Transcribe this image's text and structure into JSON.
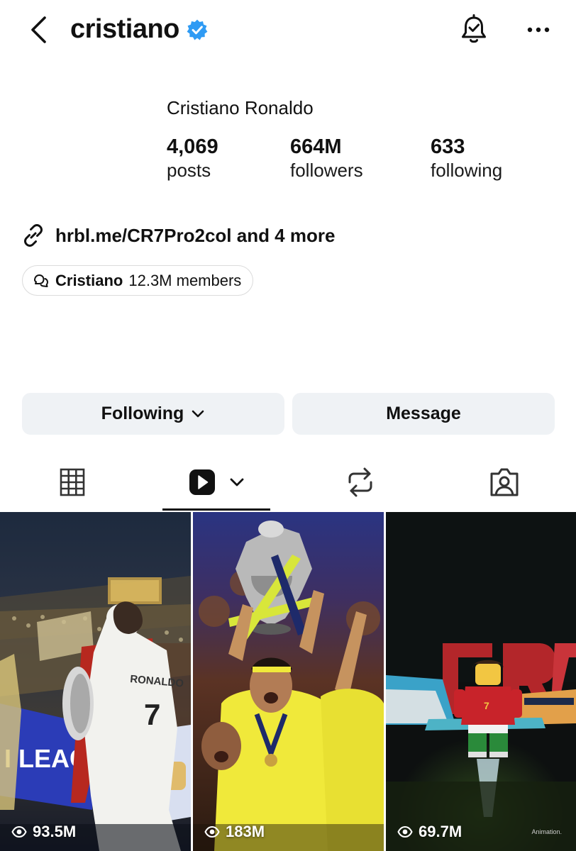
{
  "header": {
    "username": "cristiano",
    "icons": {
      "back": "back-chevron-icon",
      "verified": "verified-badge-icon",
      "notifications": "bell-check-icon",
      "more": "more-dots-icon"
    },
    "colors": {
      "verified": "#2f9bf4"
    }
  },
  "profile": {
    "full_name": "Cristiano Ronaldo",
    "stats": [
      {
        "value": "4,069",
        "label": "posts"
      },
      {
        "value": "664M",
        "label": "followers"
      },
      {
        "value": "633",
        "label": "following"
      }
    ],
    "link_text": "hrbl.me/CR7Pro2col and 4 more",
    "community": {
      "name": "Cristiano",
      "members": "12.3M members"
    }
  },
  "actions": {
    "following_label": "Following",
    "message_label": "Message"
  },
  "tabs": [
    {
      "name": "grid",
      "icon": "grid-icon",
      "active": false
    },
    {
      "name": "reels",
      "icon": "reels-icon",
      "active": true
    },
    {
      "name": "reposts",
      "icon": "repost-icon",
      "active": false
    },
    {
      "name": "tagged",
      "icon": "tagged-person-icon",
      "active": false
    }
  ],
  "reels": [
    {
      "views": "93.5M"
    },
    {
      "views": "183M"
    },
    {
      "views": "69.7M",
      "caption": "Animation."
    }
  ]
}
